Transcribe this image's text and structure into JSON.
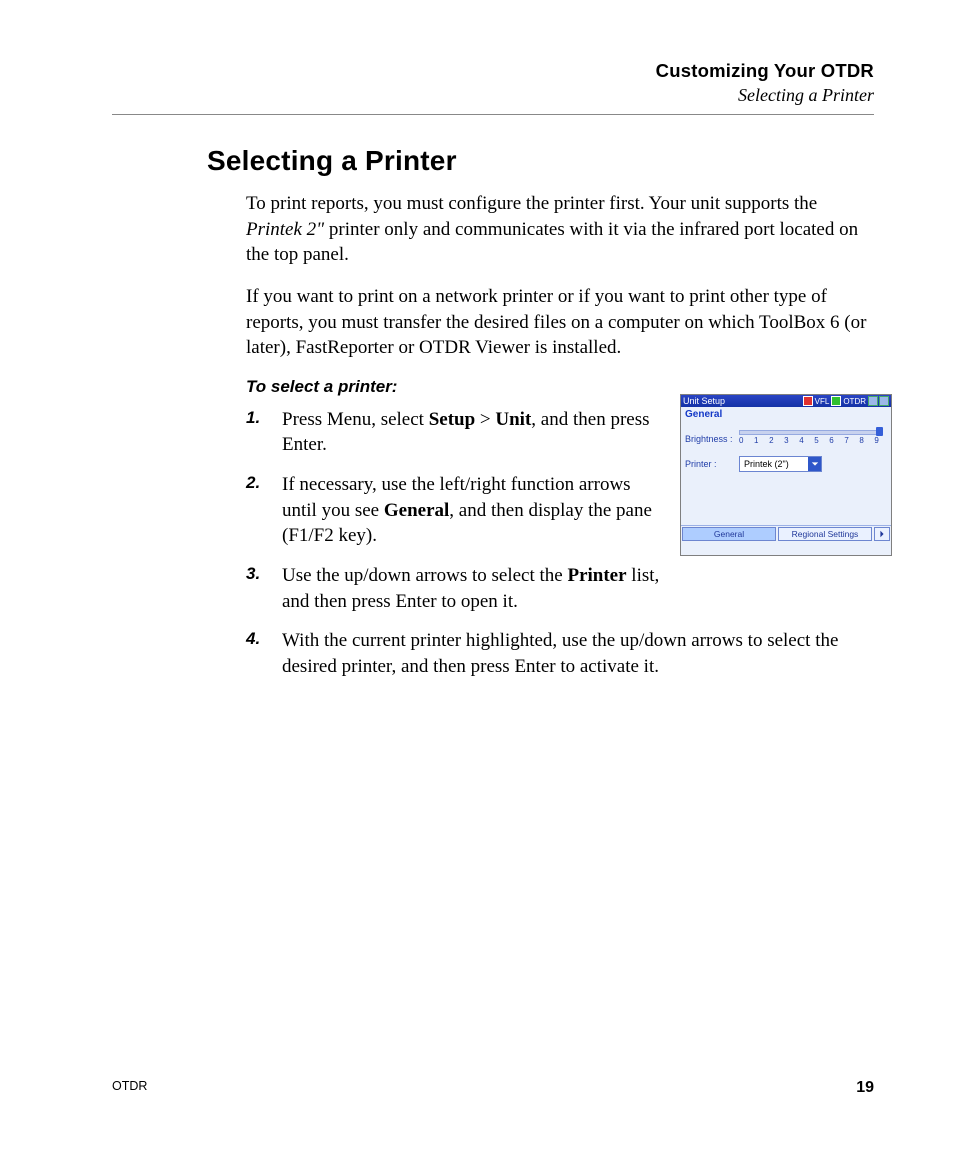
{
  "header": {
    "chapter": "Customizing Your OTDR",
    "section": "Selecting a Printer"
  },
  "title": "Selecting a Printer",
  "para1": {
    "a": "To print reports, you must configure the printer first. Your unit supports the ",
    "b": "Printek 2\"",
    "c": " printer only and communicates with it via the infrared port located on the top panel."
  },
  "para2": "If you want to print on a network printer or if you want to print other type of reports, you must transfer the desired files on a computer on which ToolBox 6 (or later), FastReporter or OTDR Viewer is installed.",
  "subhead": "To select a printer:",
  "steps": {
    "s1": {
      "num": "1.",
      "a": "Press Menu, select ",
      "b": "Setup",
      "gt": " > ",
      "c": "Unit",
      "d": ", and then press Enter."
    },
    "s2": {
      "num": "2.",
      "a": "If necessary, use the left/right function arrows until you see ",
      "b": "General",
      "c": ", and then display the pane (F1/F2 key)."
    },
    "s3": {
      "num": "3.",
      "a": "Use the up/down arrows to select the ",
      "b": "Printer",
      "c": " list, and then press Enter to open it."
    },
    "s4": {
      "num": "4.",
      "a": "With the current printer highlighted, use the up/down arrows to select the desired printer, and then press Enter to activate it."
    }
  },
  "ui": {
    "title": "Unit Setup",
    "vfl": "VFL",
    "otdr": "OTDR",
    "tab": "General",
    "brightness_label": "Brightness :",
    "ticks": [
      "0",
      "1",
      "2",
      "3",
      "4",
      "5",
      "6",
      "7",
      "8",
      "9"
    ],
    "printer_label": "Printer :",
    "printer_value": "Printek (2\")",
    "btab1": "General",
    "btab2": "Regional Settings"
  },
  "footer": {
    "product": "OTDR",
    "page": "19"
  }
}
